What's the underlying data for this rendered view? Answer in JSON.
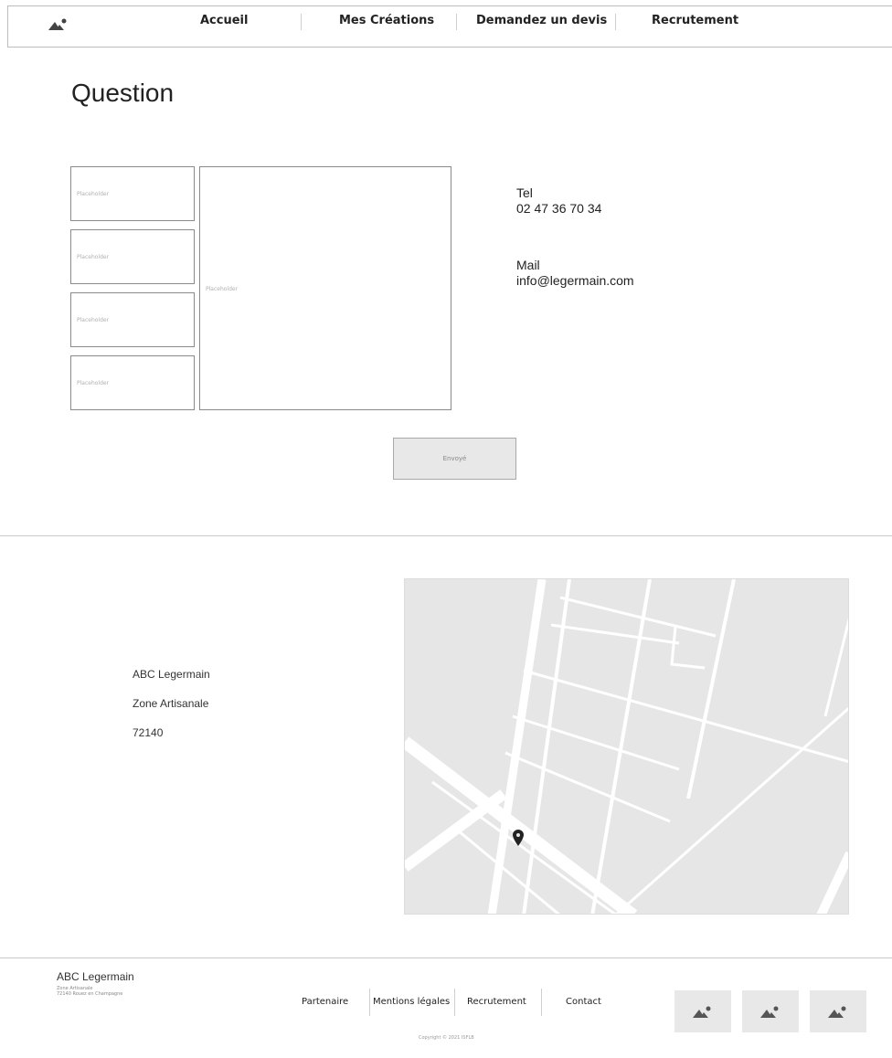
{
  "nav": {
    "logo_icon": "image-placeholder-icon",
    "items": [
      {
        "label": "Accueil"
      },
      {
        "label": "Mes Créations"
      },
      {
        "label": "Demandez un devis"
      },
      {
        "label": "Recrutement"
      }
    ]
  },
  "question": {
    "title": "Question",
    "small_fields": [
      {
        "placeholder": "Placeholder"
      },
      {
        "placeholder": "Placeholder"
      },
      {
        "placeholder": "Placeholder"
      },
      {
        "placeholder": "Placeholder"
      }
    ],
    "message_field": {
      "placeholder": "Placeholder"
    },
    "send_label": "Envoyé"
  },
  "contact": {
    "tel_label": "Tel",
    "tel_value": "02 47 36 70 34",
    "mail_label": "Mail",
    "mail_value": "info@legermain.com"
  },
  "address": {
    "name": "ABC Legermain",
    "line1": "Zone Artisanale",
    "postal": "72140"
  },
  "map": {
    "pin_icon": "map-pin-icon",
    "colors": {
      "background": "#e6e6e6",
      "roads": "#ffffff",
      "pin": "#222222"
    }
  },
  "footer": {
    "brand": "ABC Legermain",
    "brand_line1": "Zone Artisanale",
    "brand_line2": "72140 Rouez en Champagne",
    "links": [
      {
        "label": "Partenaire"
      },
      {
        "label": "Mentions légales"
      },
      {
        "label": "Recrutement"
      },
      {
        "label": "Contact"
      }
    ],
    "copyright": "Copyright © 2021 ISFLB",
    "thumb_icons": [
      "image-placeholder-icon",
      "image-placeholder-icon",
      "image-placeholder-icon"
    ]
  }
}
